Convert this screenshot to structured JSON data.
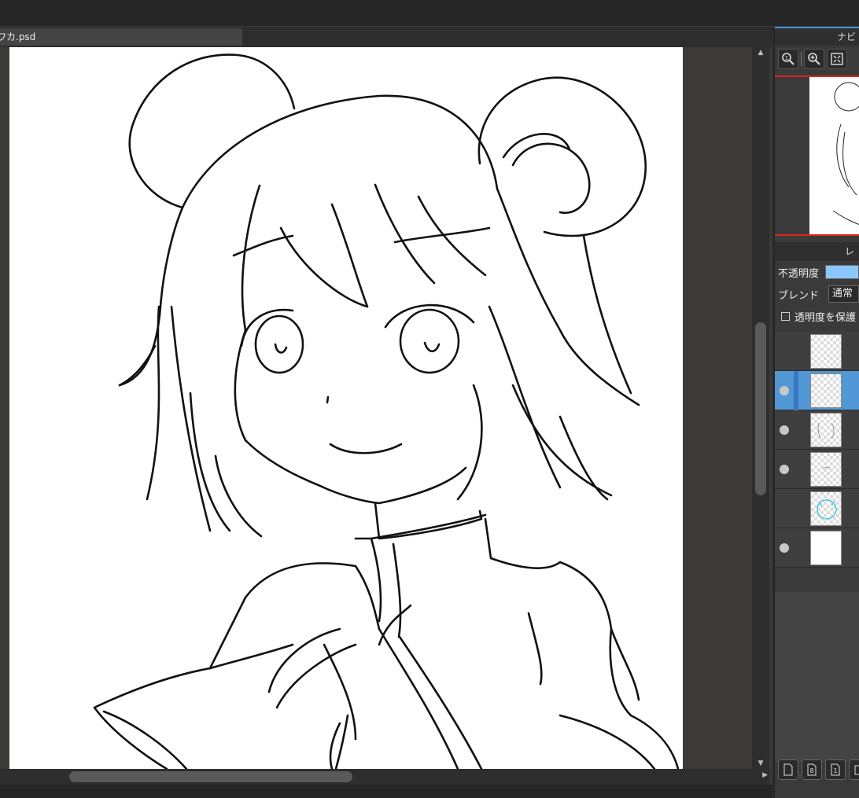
{
  "document": {
    "tab_title": "ワカ.psd"
  },
  "navigator": {
    "title": "ナビ",
    "tools": [
      {
        "name": "zoom-100-icon"
      },
      {
        "name": "zoom-in-icon"
      },
      {
        "name": "fit-screen-icon"
      }
    ]
  },
  "layer_panel": {
    "title": "レ",
    "opacity_label": "不透明度",
    "blend_label": "ブレンド",
    "blend_value": "通常",
    "protect_alpha_label": "透明度を保護",
    "layers": [
      {
        "visible": false,
        "selected": false,
        "thumb": "blank"
      },
      {
        "visible": true,
        "selected": true,
        "thumb": "sketch"
      },
      {
        "visible": true,
        "selected": false,
        "thumb": "sketch"
      },
      {
        "visible": true,
        "selected": false,
        "thumb": "sketch"
      },
      {
        "visible": false,
        "selected": false,
        "thumb": "cyan"
      },
      {
        "visible": true,
        "selected": false,
        "thumb": "white"
      }
    ],
    "bottom_buttons": [
      "new-layer-icon",
      "new-8bit-layer-icon",
      "new-1bit-layer-icon",
      "layer-folder-icon"
    ]
  },
  "colors": {
    "accent": "#4a8fd6",
    "selected_layer": "#5398d6",
    "opacity_fill": "#8cc7ff"
  }
}
